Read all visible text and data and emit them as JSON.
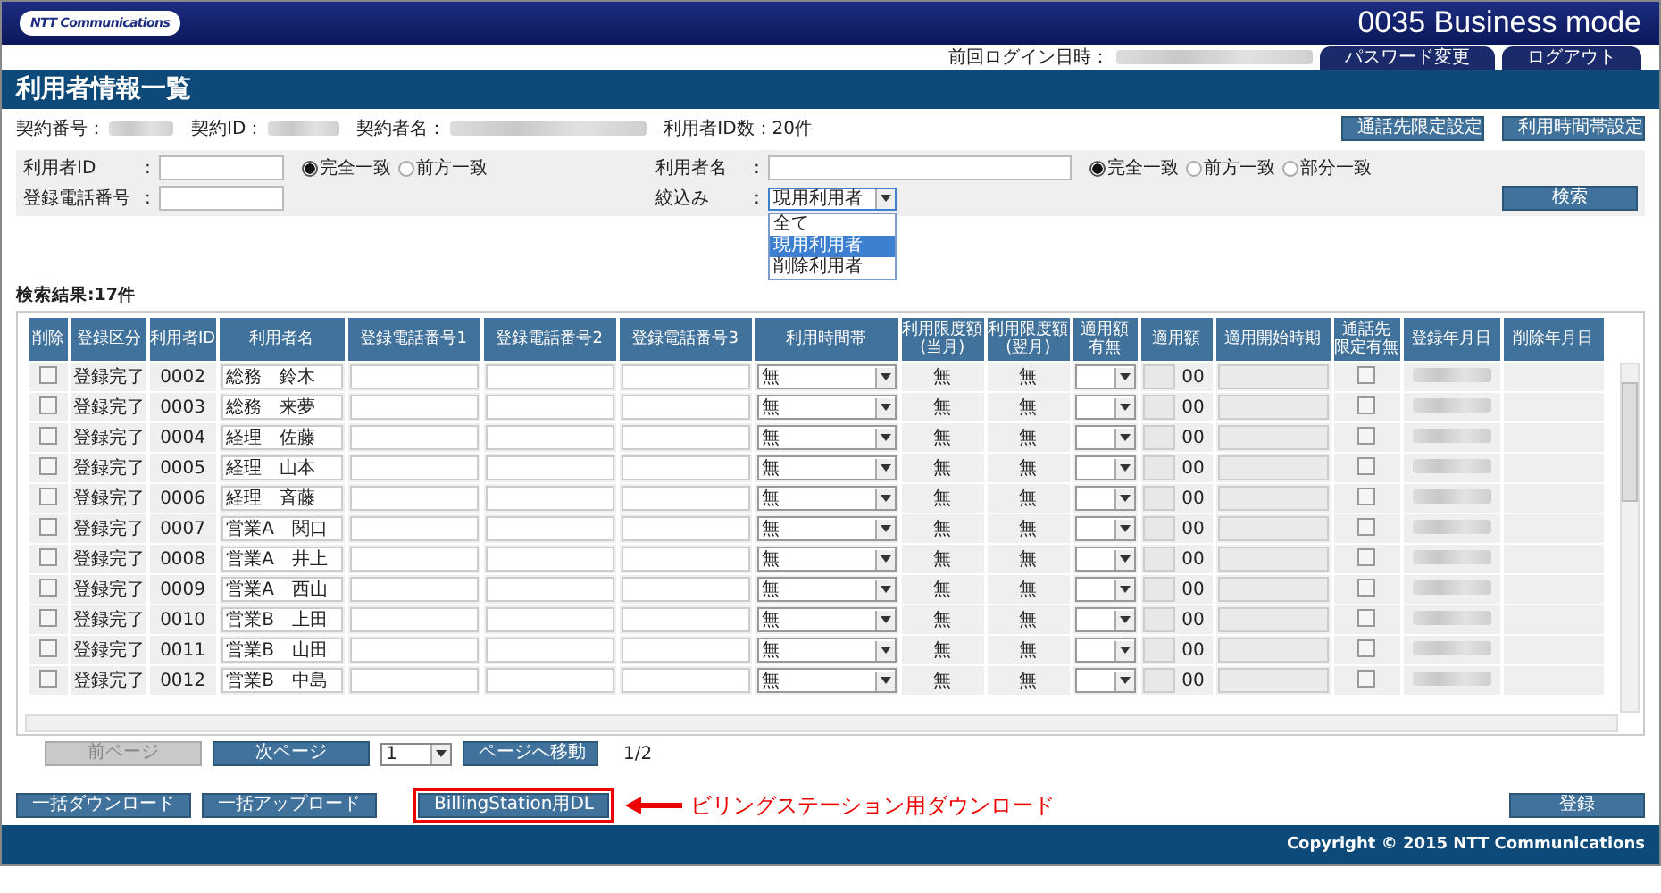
{
  "header": {
    "logo_text": "NTT Communications",
    "product": "0035 Business mode",
    "last_login_label": "前回ログイン日時：",
    "tabs": [
      "パスワード変更",
      "ログアウト"
    ]
  },
  "page_title": "利用者情報一覧",
  "contract_info": [
    {
      "label": "契約番号："
    },
    {
      "label": "契約ID："
    },
    {
      "label": "契約者名："
    }
  ],
  "user_count": "利用者ID数：20件",
  "top_buttons": [
    "通話先限定設定",
    "利用時間帯設定"
  ],
  "search": {
    "fields": [
      {
        "label": "利用者ID",
        "separator": ":",
        "match_options": [
          {
            "label": "完全一致",
            "selected": true
          },
          {
            "label": "前方一致",
            "selected": false
          }
        ]
      },
      {
        "label": "利用者名",
        "separator": ":",
        "match_options": [
          {
            "label": "完全一致",
            "selected": true
          },
          {
            "label": "前方一致",
            "selected": false
          },
          {
            "label": "部分一致",
            "selected": false
          }
        ]
      },
      {
        "label": "登録電話番号",
        "separator": ":"
      }
    ],
    "filter": {
      "label": "絞込み",
      "separator": ":",
      "value": "現用利用者",
      "expanded": true,
      "options": [
        {
          "label": "全て",
          "selected": false
        },
        {
          "label": "現用利用者",
          "selected": true
        },
        {
          "label": "削除利用者",
          "selected": false
        }
      ]
    },
    "button": "検索"
  },
  "result_count": "検索結果:17件",
  "table": {
    "columns": [
      [
        "削除"
      ],
      [
        "登録区分"
      ],
      [
        "利用者ID"
      ],
      [
        "利用者名"
      ],
      [
        "登録電話番号1"
      ],
      [
        "登録電話番号2"
      ],
      [
        "登録電話番号3"
      ],
      [
        "利用時間帯"
      ],
      [
        "利用限度額",
        "(当月)"
      ],
      [
        "利用限度額",
        "(翌月)"
      ],
      [
        "適用額",
        "有無"
      ],
      [
        "適用額"
      ],
      [
        "適用開始時期"
      ],
      [
        "通話先",
        "限定有無"
      ],
      [
        "登録年月日"
      ],
      [
        "削除年月日"
      ]
    ],
    "rows": [
      {
        "deleted": false,
        "status": "登録完了",
        "user_id": "0002",
        "name": "総務　鈴木",
        "time_band": "無",
        "limit_this_month": "無",
        "limit_next_month": "無",
        "amount_suffix": "00",
        "restricted": false
      },
      {
        "deleted": false,
        "status": "登録完了",
        "user_id": "0003",
        "name": "総務　来夢",
        "time_band": "無",
        "limit_this_month": "無",
        "limit_next_month": "無",
        "amount_suffix": "00",
        "restricted": false
      },
      {
        "deleted": false,
        "status": "登録完了",
        "user_id": "0004",
        "name": "経理　佐藤",
        "time_band": "無",
        "limit_this_month": "無",
        "limit_next_month": "無",
        "amount_suffix": "00",
        "restricted": false
      },
      {
        "deleted": false,
        "status": "登録完了",
        "user_id": "0005",
        "name": "経理　山本",
        "time_band": "無",
        "limit_this_month": "無",
        "limit_next_month": "無",
        "amount_suffix": "00",
        "restricted": false
      },
      {
        "deleted": false,
        "status": "登録完了",
        "user_id": "0006",
        "name": "経理　斉藤",
        "time_band": "無",
        "limit_this_month": "無",
        "limit_next_month": "無",
        "amount_suffix": "00",
        "restricted": false
      },
      {
        "deleted": false,
        "status": "登録完了",
        "user_id": "0007",
        "name": "営業A　関口",
        "time_band": "無",
        "limit_this_month": "無",
        "limit_next_month": "無",
        "amount_suffix": "00",
        "restricted": false
      },
      {
        "deleted": false,
        "status": "登録完了",
        "user_id": "0008",
        "name": "営業A　井上",
        "time_band": "無",
        "limit_this_month": "無",
        "limit_next_month": "無",
        "amount_suffix": "00",
        "restricted": false
      },
      {
        "deleted": false,
        "status": "登録完了",
        "user_id": "0009",
        "name": "営業A　西山",
        "time_band": "無",
        "limit_this_month": "無",
        "limit_next_month": "無",
        "amount_suffix": "00",
        "restricted": false
      },
      {
        "deleted": false,
        "status": "登録完了",
        "user_id": "0010",
        "name": "営業B　上田",
        "time_band": "無",
        "limit_this_month": "無",
        "limit_next_month": "無",
        "amount_suffix": "00",
        "restricted": false
      },
      {
        "deleted": false,
        "status": "登録完了",
        "user_id": "0011",
        "name": "営業B　山田",
        "time_band": "無",
        "limit_this_month": "無",
        "limit_next_month": "無",
        "amount_suffix": "00",
        "restricted": false
      },
      {
        "deleted": false,
        "status": "登録完了",
        "user_id": "0012",
        "name": "営業B　中島",
        "time_band": "無",
        "limit_this_month": "無",
        "limit_next_month": "無",
        "amount_suffix": "00",
        "restricted": false
      }
    ]
  },
  "pagination": {
    "prev": {
      "label": "前ページ",
      "disabled": true
    },
    "next": {
      "label": "次ページ",
      "disabled": false
    },
    "page_value": "1",
    "go": "ページへ移動",
    "page_info": "1/2"
  },
  "bottom_buttons": [
    {
      "label": "一括ダウンロード",
      "highlighted": false
    },
    {
      "label": "一括アップロード",
      "highlighted": false
    },
    {
      "label": "BillingStation用DL",
      "highlighted": true
    }
  ],
  "annotation": "ビリングステーション用ダウンロード",
  "register_button": "登録",
  "footer": {
    "copyright": "Copyright © 2015 NTT Communications"
  }
}
